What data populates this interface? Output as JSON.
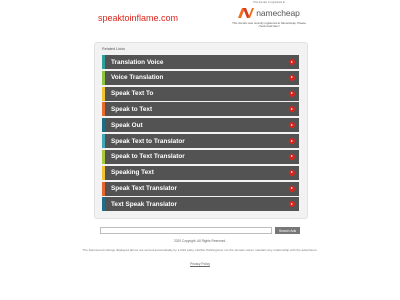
{
  "header": {
    "domain": "speaktoinflame.com",
    "registered_note": "This domain is registered at",
    "registrar_name": "namecheap",
    "expired_note": "This domain was recently registered at Namecheap. Please check back later!"
  },
  "related": {
    "title": "Related Links",
    "links": [
      {
        "label": "Translation Voice",
        "color": "#2f9f9a"
      },
      {
        "label": "Voice Translation",
        "color": "#8cc43f"
      },
      {
        "label": "Speak Text To",
        "color": "#f2c230"
      },
      {
        "label": "Speak to Text",
        "color": "#e86a2f"
      },
      {
        "label": "Speak Out",
        "color": "#1c6e85"
      },
      {
        "label": "Speak Text to Translator",
        "color": "#3fa9b4"
      },
      {
        "label": "Speak to Text Translator",
        "color": "#a7c93b"
      },
      {
        "label": "Speaking Text",
        "color": "#f2c230"
      },
      {
        "label": "Speak Text Translator",
        "color": "#e8672e"
      },
      {
        "label": "Text Speak Translator",
        "color": "#1d6f8a"
      }
    ]
  },
  "search": {
    "placeholder": "",
    "button_label": "Search Ads"
  },
  "footer": {
    "copyright": "2020 Copyright. All Rights Reserved.",
    "disclaimer": "The Sponsored Listings displayed above are served automatically by a third party. Neither Parkingcrew nor the domain owner maintain any relationship with the advertisers.",
    "privacy": "Privacy Policy"
  }
}
